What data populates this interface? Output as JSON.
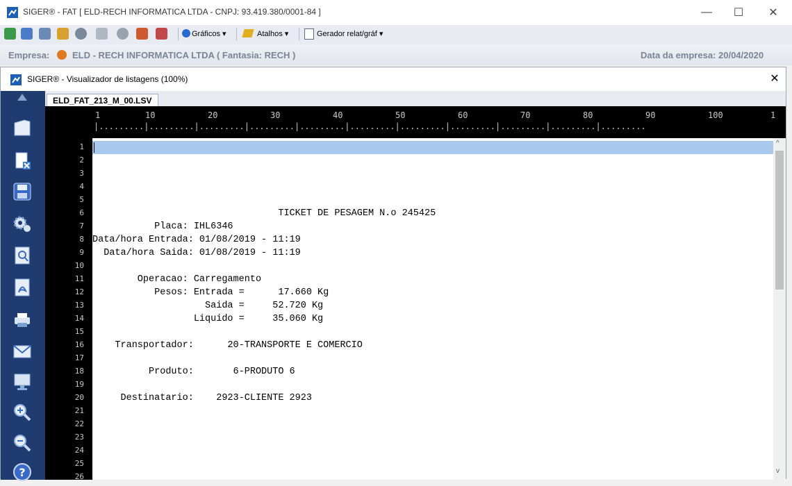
{
  "main_window": {
    "title": "SIGER® - FAT [ ELD-RECH INFORMATICA LTDA - CNPJ: 93.419.380/0001-84 ]",
    "minimize": "—",
    "maximize": "☐",
    "close": "✕"
  },
  "toolbar": {
    "graficos": "Gráficos ▾",
    "atalhos": "Atalhos ▾",
    "gerador": "Gerador relat/gráf ▾"
  },
  "empresa_bar": {
    "label": "Empresa:",
    "name": "ELD - RECH INFORMATICA LTDA ( Fantasia: RECH )",
    "date_label": "Data da empresa: 20/04/2020"
  },
  "viewer": {
    "title": "SIGER® - Visualizador de listagens (100%)",
    "close": "✕",
    "tab": "ELD_FAT_213_M_00.LSV"
  },
  "ruler": {
    "numbers": [
      "1",
      "10",
      "20",
      "30",
      "40",
      "50",
      "60",
      "70",
      "80",
      "90",
      "100",
      "1"
    ]
  },
  "document": {
    "line_numbers": [
      "1",
      "2",
      "3",
      "4",
      "5",
      "6",
      "7",
      "8",
      "9",
      "10",
      "11",
      "12",
      "13",
      "14",
      "15",
      "16",
      "17",
      "18",
      "19",
      "20",
      "21",
      "22",
      "23",
      "24",
      "25",
      "26"
    ],
    "lines": [
      "",
      "",
      "",
      "",
      "",
      "                                 TICKET DE PESAGEM N.o 245425",
      "           Placa: IHL6346",
      "Data/hora Entrada: 01/08/2019 - 11:19",
      "  Data/hora Saida: 01/08/2019 - 11:19",
      "",
      "        Operacao: Carregamento",
      "           Pesos: Entrada =      17.660 Kg",
      "                    Saida =     52.720 Kg",
      "                  Liquido =     35.060 Kg",
      "",
      "    Transportador:      20-TRANSPORTE E COMERCIO",
      "",
      "          Produto:       6-PRODUTO 6",
      "",
      "     Destinatario:    2923-CLIENTE 2923",
      "",
      "",
      "",
      "",
      "",
      ""
    ]
  }
}
